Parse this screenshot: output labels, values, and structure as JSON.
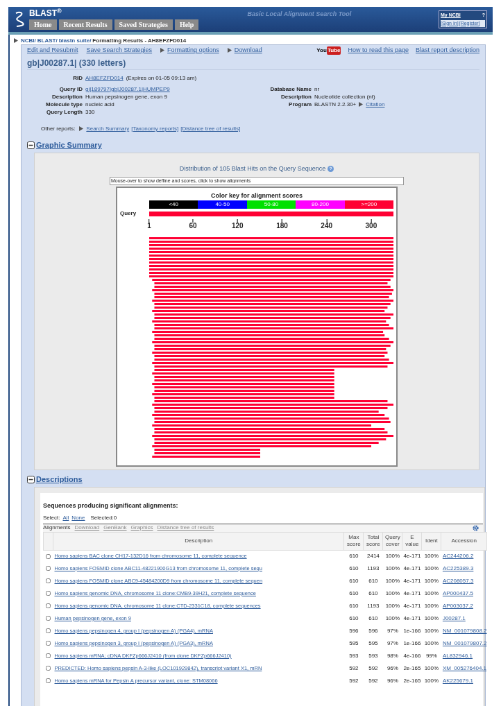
{
  "header": {
    "logo": "BLAST$^{®}$",
    "tagline": "Basic Local Alignment Search Tool",
    "tabs": [
      {
        "label": "Home",
        "selected": false
      },
      {
        "label": "Recent Results",
        "selected": false
      },
      {
        "label": "Saved Strategies",
        "selected": false
      },
      {
        "label": "Help",
        "selected": false
      }
    ],
    "account": {
      "title": "My NCBI",
      "help": "?",
      "sign_in": "[Sign In]",
      "register": "[Register]"
    }
  },
  "breadcrumb": {
    "links": [
      "NCBI/",
      "BLAST/",
      "blastn suite/"
    ],
    "current": "Formatting Results - AH8EFZFD014"
  },
  "actions": [
    {
      "label": "Edit and Resubmit",
      "arrow": false
    },
    {
      "label": "Save Search Strategies",
      "arrow": false
    },
    {
      "label": "Formatting options",
      "arrow": true
    },
    {
      "label": "Download",
      "arrow": true
    }
  ],
  "help_links": {
    "video_logo": [
      "You",
      "Tube"
    ],
    "links": [
      "How to read this page",
      "Blast report description"
    ]
  },
  "query_title": "gb|J00287.1| (330 letters)",
  "rid": {
    "label": "RID",
    "value": "AH8EFZFD014",
    "note": "(Expires on 01-05 09:13 am)"
  },
  "query_info": [
    {
      "label": "Query ID",
      "value": "gi|189797|gb|J00287.1|HUMPEP9",
      "kind": "link"
    },
    {
      "label": "Description",
      "value": "Human pepsinogen gene, exon 9",
      "kind": "text"
    },
    {
      "label": "Molecule type",
      "value": "nucleic acid",
      "kind": "text"
    },
    {
      "label": "Query Length",
      "value": "330",
      "kind": "text"
    }
  ],
  "database_info": [
    {
      "label": "Database Name",
      "value": "nr"
    },
    {
      "label": "Description",
      "value": "Nucleotide collection (nt)"
    },
    {
      "label": "Program",
      "value": "BLASTN 2.2.30+",
      "link": "Citation"
    }
  ],
  "other_reports": {
    "label": "Other reports:",
    "links": [
      {
        "label": "Search Summary",
        "arrow": true
      },
      {
        "label": "[Taxonomy reports]",
        "arrow": false
      },
      {
        "label": "[Distance tree of results]",
        "arrow": false
      }
    ]
  },
  "graphic_summary": {
    "heading": "Graphic Summary",
    "expanded": true,
    "title": "Distribution of 105 Blast Hits on the Query Sequence",
    "value": "Mouse-over to show defline and scores, click to show alignments",
    "key_title": "Color key for alignment scores",
    "key": [
      {
        "label": "<40",
        "color": "#000000"
      },
      {
        "label": "40-50",
        "color": "#0000ff"
      },
      {
        "label": "50-80",
        "color": "#00e000"
      },
      {
        "label": "80-200",
        "color": "#ff00ff"
      },
      {
        "label": ">=200",
        "color": "#ff0033"
      }
    ],
    "query_label": "Query",
    "ticks": [
      "1",
      "60",
      "120",
      "180",
      "240",
      "300"
    ]
  },
  "descriptions": {
    "heading": "Descriptions",
    "expanded": true,
    "subtitle": "Sequences producing significant alignments:",
    "select_label": "Select:",
    "select_all": "All",
    "select_none": "None",
    "selected_count": "Selected:0",
    "toolbar": [
      {
        "label": "Alignments",
        "disabled": false
      },
      {
        "label": "Download",
        "disabled": true
      },
      {
        "label": "GenBank",
        "disabled": true
      },
      {
        "label": "Graphics",
        "disabled": true
      },
      {
        "label": "Distance tree of results",
        "disabled": true
      }
    ],
    "columns": [
      "Description",
      "Max score",
      "Total score",
      "Query cover",
      "E value",
      "Ident",
      "Accession"
    ],
    "rows": [
      {
        "checked": false,
        "description": "Homo sapiens BAC clone CH17-132D16 from chromosome 11, complete sequence",
        "max": "610",
        "total": "2414",
        "cover": "100%",
        "evalue": "4e-171",
        "ident": "100%",
        "accession": "AC244206.2"
      },
      {
        "checked": false,
        "description": "Homo sapiens FOSMID clone ABC11-48221900G13 from chromosome 11, complete sequ",
        "max": "610",
        "total": "1193",
        "cover": "100%",
        "evalue": "4e-171",
        "ident": "100%",
        "accession": "AC225389.3"
      },
      {
        "checked": false,
        "description": "Homo sapiens FOSMID clone ABC9-45484200D9 from chromosome 11, complete sequen",
        "max": "610",
        "total": "610",
        "cover": "100%",
        "evalue": "4e-171",
        "ident": "100%",
        "accession": "AC208057.3"
      },
      {
        "checked": false,
        "description": "Homo sapiens genomic DNA, chromosome 11 clone:CMB9-39H21, complete sequence",
        "max": "610",
        "total": "610",
        "cover": "100%",
        "evalue": "4e-171",
        "ident": "100%",
        "accession": "AP000437.5"
      },
      {
        "checked": false,
        "description": "Homo sapiens genomic DNA, chromosome 11 clone:CTD-2331C18, complete sequences",
        "max": "610",
        "total": "1193",
        "cover": "100%",
        "evalue": "4e-171",
        "ident": "100%",
        "accession": "AP003037.2"
      },
      {
        "checked": false,
        "description": "Human pepsinogen gene, exon 9",
        "max": "610",
        "total": "610",
        "cover": "100%",
        "evalue": "4e-171",
        "ident": "100%",
        "accession": "J00287.1"
      },
      {
        "checked": false,
        "description": "Homo sapiens pepsinogen 4, group I (pepsinogen A) (PGA4), mRNA",
        "max": "596",
        "total": "596",
        "cover": "97%",
        "evalue": "1e-166",
        "ident": "100%",
        "accession": "NM_001079808.2"
      },
      {
        "checked": false,
        "description": "Homo sapiens pepsinogen 3, group I (pepsinogen A) (PGA3), mRNA",
        "max": "595",
        "total": "595",
        "cover": "97%",
        "evalue": "1e-166",
        "ident": "100%",
        "accession": "NM_001079807.2"
      },
      {
        "checked": false,
        "description": "Homo sapiens mRNA; cDNA DKFZp666J2410 (from clone DKFZp666J2410)",
        "max": "593",
        "total": "593",
        "cover": "98%",
        "evalue": "4e-166",
        "ident": "99%",
        "accession": "AL832946.1"
      },
      {
        "checked": false,
        "description": "PREDICTED: Homo sapiens pepsin A-3-like (LOC101929842), transcript variant X1, mRN",
        "max": "592",
        "total": "592",
        "cover": "96%",
        "evalue": "2e-165",
        "ident": "100%",
        "accession": "XM_005276404.1"
      },
      {
        "checked": false,
        "description": "Homo sapiens mRNA for Pepsin A precursor variant, clone: STM08066",
        "max": "592",
        "total": "592",
        "cover": "96%",
        "evalue": "2e-165",
        "ident": "100%",
        "accession": "AK225679.1"
      }
    ]
  }
}
